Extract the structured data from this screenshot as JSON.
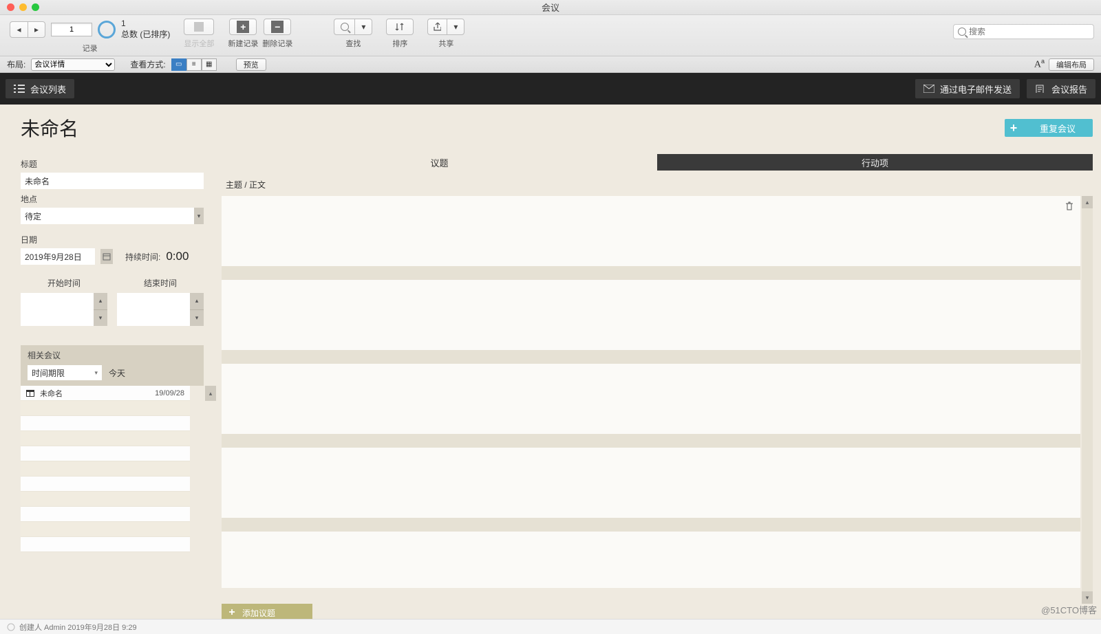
{
  "window": {
    "title": "会议"
  },
  "toolbar": {
    "record_index": "1",
    "record_count": "1",
    "record_status": "总数 (已排序)",
    "groups": {
      "records": "记录",
      "show_all": "显示全部",
      "new_record": "新建记录",
      "delete_record": "删除记录",
      "find": "查找",
      "sort": "排序",
      "share": "共享"
    },
    "search_placeholder": "搜索"
  },
  "layoutbar": {
    "layout_label": "布局:",
    "layout_value": "会议详情",
    "view_label": "查看方式:",
    "preview": "预览",
    "edit_layout": "编辑布局"
  },
  "darkbar": {
    "meeting_list": "会议列表",
    "send_email": "通过电子邮件发送",
    "report": "会议报告"
  },
  "page": {
    "title": "未命名",
    "repeat_btn": "重复会议"
  },
  "left": {
    "title_label": "标题",
    "title_value": "未命名",
    "location_label": "地点",
    "location_value": "待定",
    "date_label": "日期",
    "date_value": "2019年9月28日",
    "duration_label": "持续时间:",
    "duration_value": "0:00",
    "start_label": "开始时间",
    "end_label": "结束时间",
    "related_label": "相关会议",
    "filter_value": "时间期限",
    "today": "今天",
    "rel_items": [
      {
        "name": "未命名",
        "date": "19/09/28"
      }
    ]
  },
  "right": {
    "tab1": "议题",
    "tab2": "行动项",
    "subheader": "主题 / 正文",
    "add_topic": "添加议题"
  },
  "status": {
    "text": "创建人 Admin 2019年9月28日  9:29"
  },
  "watermark": "@51CTO博客"
}
